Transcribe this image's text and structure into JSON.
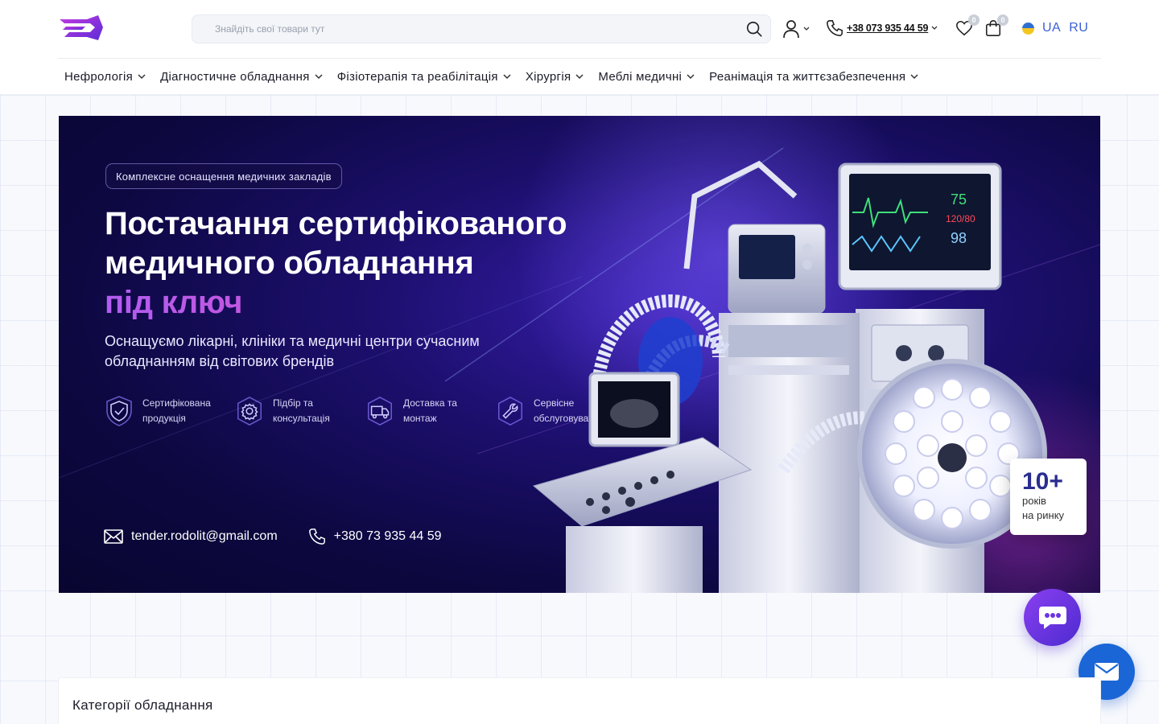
{
  "header": {
    "search": {
      "placeholder": "Знайдіть свої товари тут",
      "value": ""
    },
    "phone": "+38 073 935 44 59",
    "wishlist_count": "0",
    "cart_count": "0",
    "languages": [
      "UA",
      "RU"
    ]
  },
  "nav": {
    "items": [
      {
        "label": "Нефрологія"
      },
      {
        "label": "Діагностичне обладнання"
      },
      {
        "label": "Фізіотерапія та реабілітація"
      },
      {
        "label": "Хірургія"
      },
      {
        "label": "Меблі медичні"
      },
      {
        "label": "Реанімація та життєзабезпечення"
      }
    ]
  },
  "banner": {
    "pill": "Комплексне оснащення медичних закладів",
    "headline_line1": "Постачання сертифікованого",
    "headline_line2": "медичного обладнання",
    "headline_accent": "під ключ",
    "sub": "Оснащуємо лікарні, клініки та медичні центри сучасним обладнанням від світових брендів",
    "features": [
      {
        "icon": "shield-check-icon",
        "text": "Сертифікована продукція"
      },
      {
        "icon": "gear-icon",
        "text": "Підбір та консультація"
      },
      {
        "icon": "truck-icon",
        "text": "Доставка та монтаж"
      },
      {
        "icon": "wrench-icon",
        "text": "Сервісне обслуговування"
      }
    ],
    "email": "tender.rodolit@gmail.com",
    "phone": "+380 73 935 44 59",
    "years_big": "10+",
    "years_line1": "років",
    "years_line2": "на ринку",
    "monitor": {
      "hr": "75",
      "bp": "120/80",
      "spo2": "98"
    }
  },
  "categories": {
    "title": "Категорії обладнання"
  },
  "colors": {
    "accent": "#3c5fd4",
    "brand_purple": "#7b2ff0",
    "banner_bg": "#1c0f6e",
    "mail_button": "#1a66d6"
  }
}
